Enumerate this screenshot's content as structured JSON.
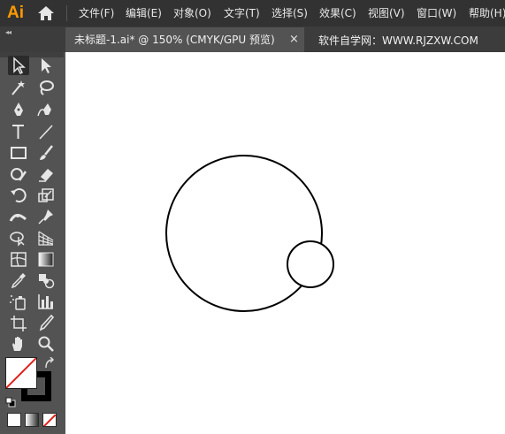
{
  "app": {
    "logo": "Ai"
  },
  "menu": [
    {
      "label": "文件(F)"
    },
    {
      "label": "编辑(E)"
    },
    {
      "label": "对象(O)"
    },
    {
      "label": "文字(T)"
    },
    {
      "label": "选择(S)"
    },
    {
      "label": "效果(C)"
    },
    {
      "label": "视图(V)"
    },
    {
      "label": "窗口(W)"
    },
    {
      "label": "帮助(H)"
    }
  ],
  "panel_collapse": "◂◂",
  "document_tab": {
    "title": "未标题-1.ai* @ 150% (CMYK/GPU 预览)",
    "close": "×"
  },
  "watermark": "软件自学网：WWW.RJZXW.COM",
  "tools": [
    "selection-tool-icon",
    "direct-selection-tool-icon",
    "magic-wand-tool-icon",
    "lasso-tool-icon",
    "pen-tool-icon",
    "curvature-tool-icon",
    "type-tool-icon",
    "line-segment-tool-icon",
    "rectangle-tool-icon",
    "paintbrush-tool-icon",
    "shaper-tool-icon",
    "eraser-tool-icon",
    "rotate-tool-icon",
    "scale-tool-icon",
    "width-tool-icon",
    "puppet-warp-tool-icon",
    "shape-builder-tool-icon",
    "perspective-grid-tool-icon",
    "mesh-tool-icon",
    "gradient-tool-icon",
    "eyedropper-tool-icon",
    "blend-tool-icon",
    "symbol-sprayer-tool-icon",
    "column-graph-tool-icon",
    "artboard-tool-icon",
    "slice-tool-icon",
    "hand-tool-icon",
    "zoom-tool-icon"
  ],
  "colors": {
    "menubar": "#323232",
    "toolbar": "#535353",
    "canvas": "#ffffff",
    "logo": "#ff9a00",
    "none_slash": "#e0201b"
  }
}
